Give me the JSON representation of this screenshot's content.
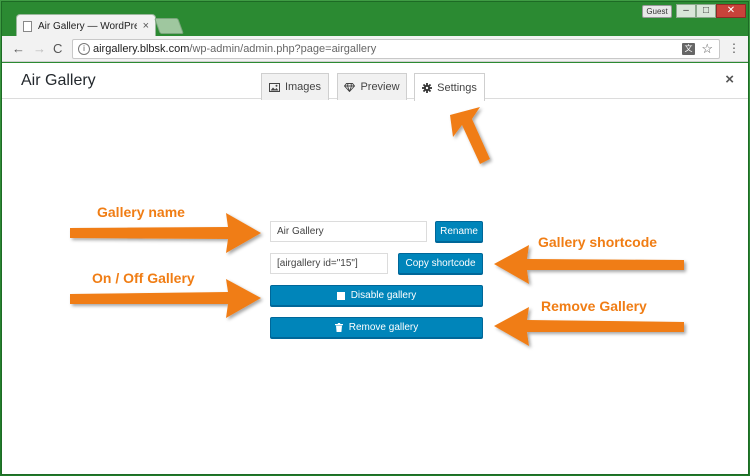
{
  "browser": {
    "tab_title": "Air Gallery — WordPress",
    "tab_close": "×",
    "guest_label": "Guest",
    "win_min": "–",
    "win_max": "□",
    "win_close": "✕",
    "nav_back": "←",
    "nav_forward": "→",
    "nav_reload": "C",
    "info_icon_glyph": "i",
    "url_host": "airgallery.blbsk.com",
    "url_path": "/wp-admin/admin.php?page=airgallery",
    "translate_glyph": "文",
    "star_glyph": "☆",
    "menu_glyph": "⋮"
  },
  "header": {
    "title": "Air Gallery",
    "close": "×",
    "tabs": [
      {
        "label": "Images",
        "icon": "image-icon"
      },
      {
        "label": "Preview",
        "icon": "diamond-icon"
      },
      {
        "label": "Settings",
        "icon": "gear-icon",
        "active": true
      }
    ]
  },
  "form": {
    "name_value": "Air Gallery",
    "rename_label": "Rename",
    "shortcode_value": "[airgallery id=\"15\"]",
    "copy_label": "Copy shortcode",
    "disable_label": "Disable gallery",
    "remove_label": "Remove gallery"
  },
  "annotations": {
    "gallery_name": "Gallery name",
    "on_off": "On / Off Gallery",
    "shortcode": "Gallery shortcode",
    "remove": "Remove Gallery"
  },
  "colors": {
    "accent": "#0085ba",
    "annotation": "#f07d14",
    "desktop": "#2f8a36"
  }
}
